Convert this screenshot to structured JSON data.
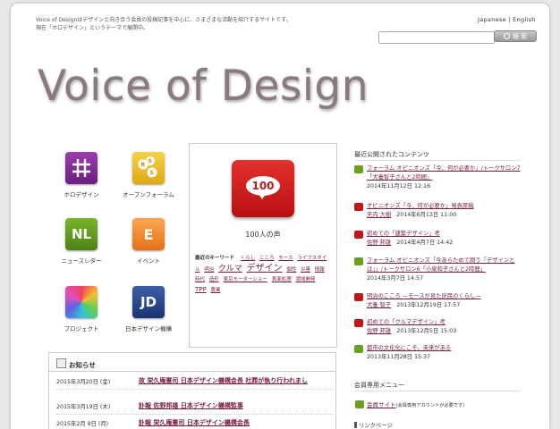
{
  "header": {
    "intro_line1": "Voice of Designはデザインと向き合う会員の投稿記事を中心に、さまざまな活動を紹介するサイトです。",
    "intro_line2": "現在「ホロデザイン」というテーマで展開中。",
    "lang_ja": "Japanese",
    "lang_sep": " | ",
    "lang_en": "English",
    "search_placeholder": "",
    "search_button": "検 索"
  },
  "logo": {
    "text": "Voice of Design"
  },
  "tiles": [
    {
      "label": "ホロデザイン",
      "glyph": "#",
      "color": "#7b2a8c"
    },
    {
      "label": "オープンフォーラム",
      "glyph": "BSS",
      "color": "#e6b81e"
    },
    {
      "label": "ニュースレター",
      "glyph": "NL",
      "color": "#5f9a1b"
    },
    {
      "label": "イベント",
      "glyph": "E",
      "color": "#ef8a2a"
    },
    {
      "label": "プロジェクト",
      "glyph": "",
      "color": "#e05080"
    },
    {
      "label": "日本デザイン機構",
      "glyph": "JD",
      "color": "#2a4a8c"
    }
  ],
  "voice": {
    "badge_number": "100",
    "label": "100人の声",
    "keywords_title": "最近のキーワード",
    "keywords": [
      "くらし",
      "こころ",
      "モース",
      "ライフスタイル",
      "明治",
      "クルマ",
      "デザイン",
      "個性",
      "災害",
      "情報",
      "時代",
      "造形",
      "東京モーターショー",
      "表面処理",
      "領域開発",
      "TPP",
      "農業"
    ]
  },
  "recent": {
    "title": "最近公開されたコンテンツ",
    "items": [
      {
        "icon": "nl",
        "title": "フォーラム オピニオンズ「今、何が必要か」/トークサロン7「犬養智子さんと2時間」",
        "author": "",
        "date": "2014年11月12日 12:16"
      },
      {
        "icon": "voice",
        "title": "オピニオンズ「今、何が必要か」発表原稿",
        "author": "天内 大樹",
        "date": "2014年6月13日 11:00"
      },
      {
        "icon": "voice",
        "title": "初めての「建築デザイン」考",
        "author": "佐野 邦雄",
        "date": "2014年4月7日 14:42"
      },
      {
        "icon": "nl",
        "title": "フォーラム オピニオンズ「今あらためて問う「デザインとは」」/トークサロン6「小泉和子さんと2時間」",
        "author": "",
        "date": "2014年3月7日 14:57"
      },
      {
        "icon": "voice",
        "title": "明治のこころ —モースが見た庶民のくらし—",
        "author": "犬養 智子",
        "date": "2013年12月19日 17:57"
      },
      {
        "icon": "voice",
        "title": "初めての「クルマデザイン」考",
        "author": "佐野 邦雄",
        "date": "2013年12月5日 15:03"
      },
      {
        "icon": "nl",
        "title": "都市の文化化にこそ、未来がある",
        "author": "",
        "date": "2013年11月28日 15:37"
      }
    ]
  },
  "member": {
    "title": "会員専用メニュー",
    "link": "会員サイト",
    "note": "(会員専用アカウントが必要です)"
  },
  "links": {
    "title": "リンクページ"
  },
  "notices": {
    "title": "お知らせ",
    "items": [
      {
        "date": "2015年3月20日 (金)",
        "text": "故 栄久庵憲司 日本デザイン機構会長 社葬が執り行われまし"
      },
      {
        "date": "2015年3月19日 (木)",
        "text": "訃報 佐野邦雄 日本デザイン機構監事"
      },
      {
        "date": "2015年2月 9日 (月)",
        "text": "訃報 栄久庵憲司 日本デザイン機構会長"
      }
    ]
  },
  "colors": {
    "link": "#7a1d44",
    "voice_red": "#c0181b",
    "nl_green": "#6aa020"
  }
}
